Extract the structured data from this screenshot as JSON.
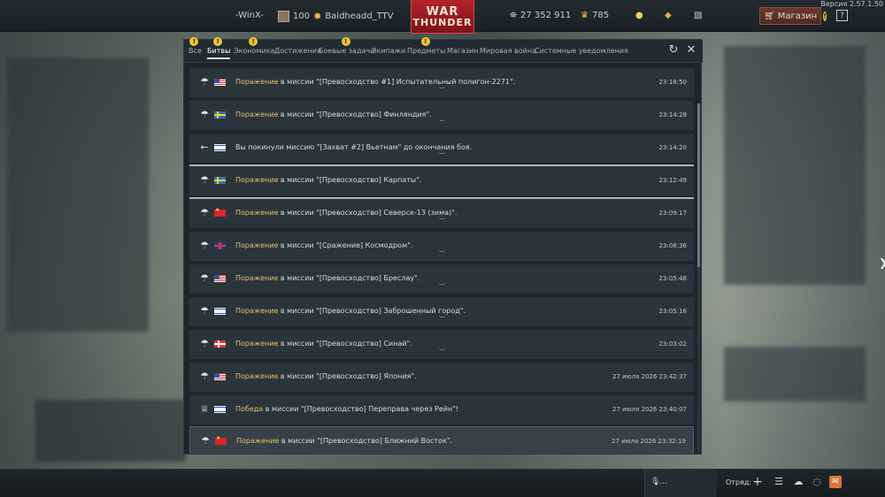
{
  "version": "Версия 2.57.1.50",
  "topbar": {
    "player_tag": "-WinX-",
    "level": "100",
    "username": "Baldheadd_TTV",
    "logo_line1": "WAR",
    "logo_line2": "THUNDER",
    "silver_lions": "27 352 911",
    "golden_eagles": "785",
    "shop_label": "Магазин",
    "help_label": "?"
  },
  "tabs": [
    {
      "label": "Все",
      "warn": true
    },
    {
      "label": "Битвы",
      "warn": true,
      "active": true
    },
    {
      "label": "Экономика",
      "warn": true
    },
    {
      "label": "Достижения",
      "warn": false
    },
    {
      "label": "Боевые задачи",
      "warn": true
    },
    {
      "label": "Экипажи",
      "warn": false
    },
    {
      "label": "Предметы",
      "warn": true
    },
    {
      "label": "Магазин",
      "warn": false
    },
    {
      "label": "Мировая война",
      "warn": false
    },
    {
      "label": "Системные уведомления",
      "warn": false
    }
  ],
  "messages": [
    {
      "icon": "parachute",
      "flag": "us",
      "result": "Поражение",
      "text": " в миссии \"[Превосходство #1] Испытательный полигон-2271\".",
      "time": "23:18:50"
    },
    {
      "icon": "parachute",
      "flag": "se",
      "result": "Поражение",
      "text": " в миссии \"[Превосходство] Финляндия\".",
      "time": "23:14:28"
    },
    {
      "icon": "leave",
      "flag": "il",
      "result": "",
      "text": "Вы покинули миссию \"[Захват #2] Вьетнам\" до окончания боя.",
      "time": "23:14:20"
    },
    {
      "icon": "parachute",
      "flag": "se",
      "result": "Поражение",
      "text": " в миссии \"[Превосходство] Карпаты\".",
      "time": "23:12:49"
    },
    {
      "icon": "parachute",
      "flag": "cn",
      "result": "Поражение",
      "text": " в миссии \"[Превосходство] Северск-13 (зима)\".",
      "time": "23:09:17"
    },
    {
      "icon": "parachute",
      "flag": "gb",
      "result": "Поражение",
      "text": " в миссии \"[Сражение] Космодром\".",
      "time": "23:08:36"
    },
    {
      "icon": "parachute",
      "flag": "us",
      "result": "Поражение",
      "text": " в миссии \"[Превосходство] Бреслау\".",
      "time": "23:05:48"
    },
    {
      "icon": "parachute",
      "flag": "il",
      "result": "Поражение",
      "text": " в миссии \"[Превосходство] Заброшенный город\".",
      "time": "23:05:16"
    },
    {
      "icon": "parachute",
      "flag": "ns",
      "result": "Поражение",
      "text": " в миссии \"[Превосходство] Синай\".",
      "time": "23:03:02"
    },
    {
      "icon": "parachute",
      "flag": "us",
      "result": "Поражение",
      "text": " в миссии \"[Превосходство] Япония\".",
      "time": "27 июля 2026 23:42:37"
    },
    {
      "icon": "trophy",
      "flag": "il",
      "result": "Победа",
      "text": " в миссии \"[Превосходство] Переправа через Рейн\"!",
      "time": "27 июля 2026 23:40:07"
    },
    {
      "icon": "parachute",
      "flag": "cn",
      "result": "Поражение",
      "text": " в миссии \"[Превосходство] Ближний Восток\".",
      "time": "27 июля 2026 23:32:19"
    }
  ],
  "bottombar": {
    "voice_ellipsis": "...",
    "squad_label": "Отряд:"
  },
  "colors": {
    "result_text": "#e6c36a",
    "dialog_bg": "#1e262c",
    "row_bg": "#2a343b",
    "logo_red": "#b5232a"
  }
}
